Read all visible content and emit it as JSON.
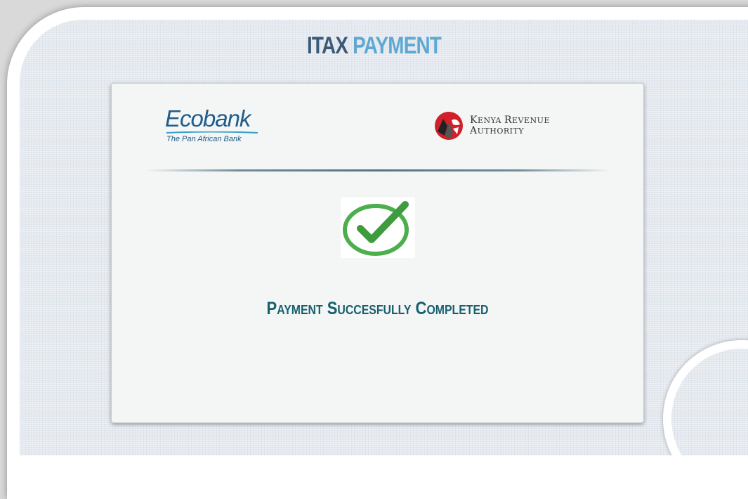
{
  "header": {
    "title_part1": "ITAX",
    "title_part2": "PAYMENT"
  },
  "logos": {
    "ecobank_name": "Ecobank",
    "ecobank_tagline": "The Pan African Bank",
    "kra_line1_initial1": "K",
    "kra_line1_rest1": "ENYA ",
    "kra_line1_initial2": "R",
    "kra_line1_rest2": "EVENUE",
    "kra_line2_initial": "A",
    "kra_line2_rest": "UTHORITY"
  },
  "status": {
    "message": "Payment Succesfully Completed",
    "icon": "success-check-icon"
  },
  "colors": {
    "title_dark": "#3c5a78",
    "title_light": "#5fa8d3",
    "status_text": "#16606e",
    "check_green": "#4cae4c",
    "kra_red": "#d0202a"
  }
}
